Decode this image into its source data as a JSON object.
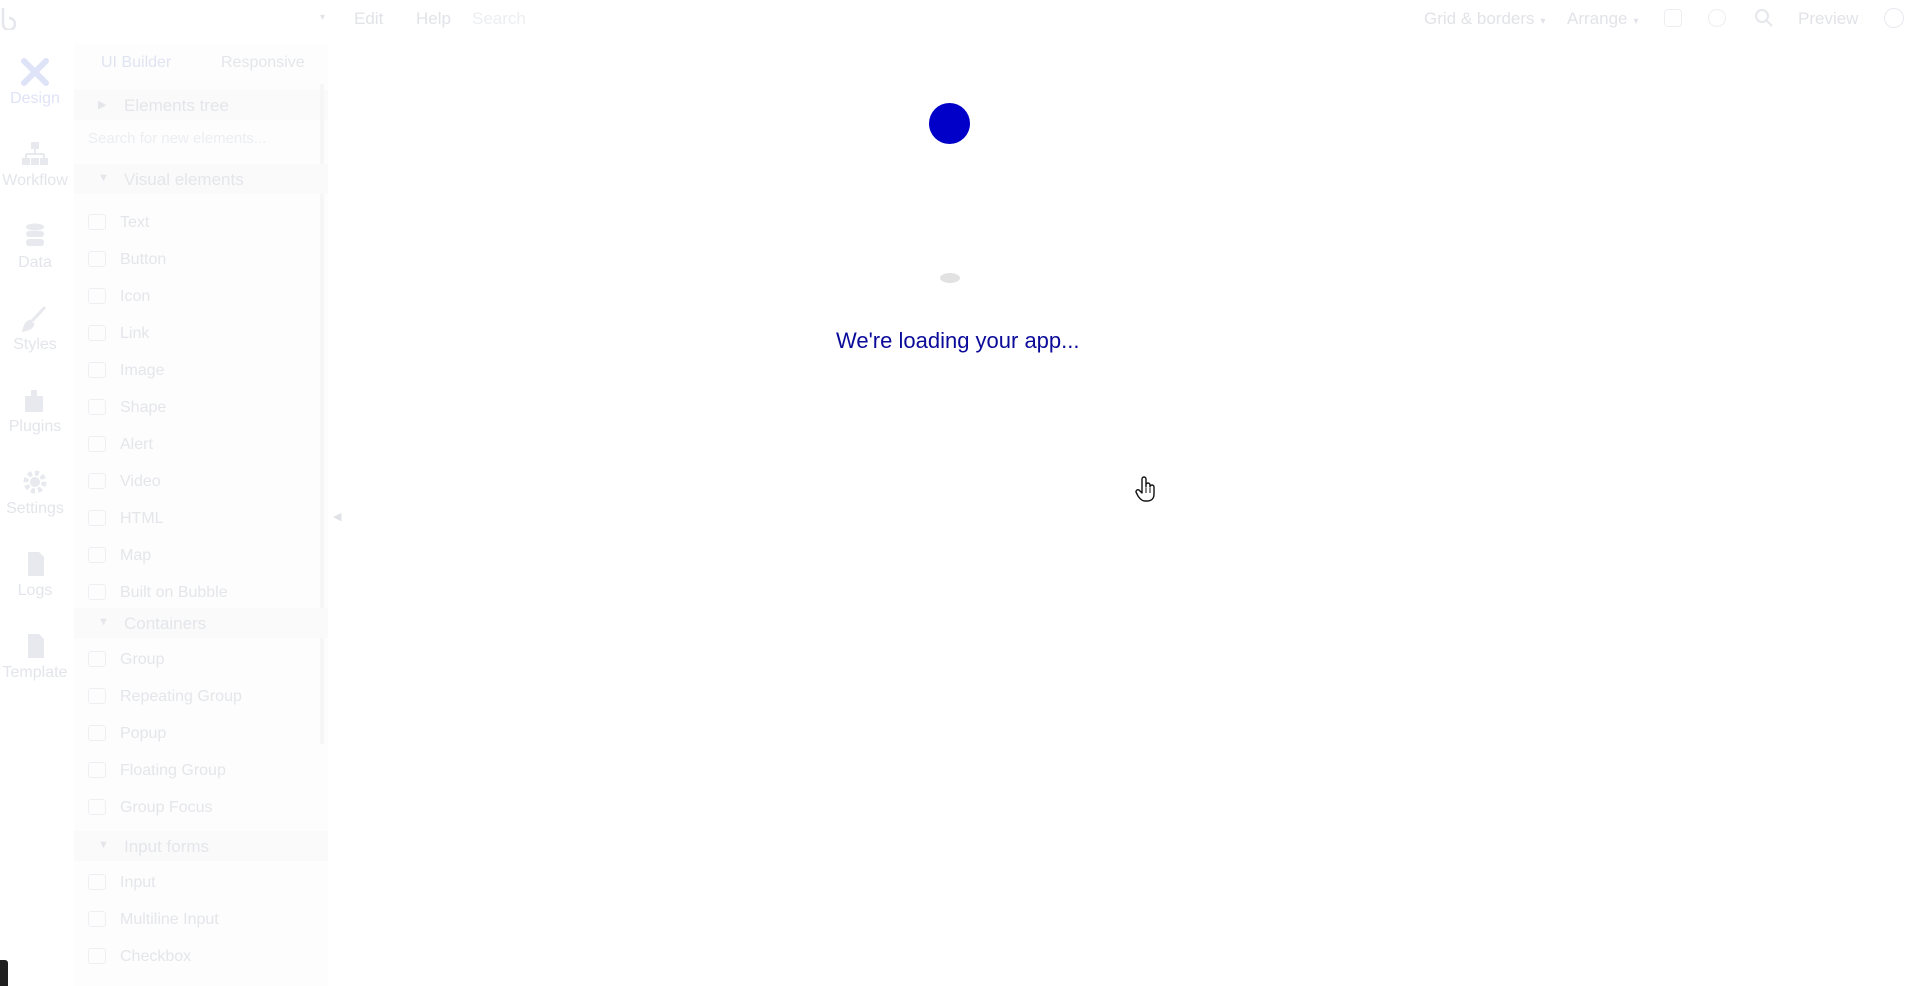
{
  "topbar": {
    "menu": [
      "Edit",
      "Help",
      "Search"
    ],
    "right": {
      "grid_label": "Grid & borders",
      "arrange_label": "Arrange",
      "preview_label": "Preview"
    }
  },
  "leftnav": {
    "items": [
      {
        "label": "Design",
        "icon": "design-icon"
      },
      {
        "label": "Workflow",
        "icon": "workflow-icon"
      },
      {
        "label": "Data",
        "icon": "data-icon"
      },
      {
        "label": "Styles",
        "icon": "styles-icon"
      },
      {
        "label": "Plugins",
        "icon": "plugins-icon"
      },
      {
        "label": "Settings",
        "icon": "settings-icon"
      },
      {
        "label": "Logs",
        "icon": "logs-icon"
      },
      {
        "label": "Template",
        "icon": "template-icon"
      }
    ]
  },
  "panel": {
    "tabs": [
      "UI Builder",
      "Responsive"
    ],
    "elements_tree": "Elements tree",
    "search_placeholder": "Search for new elements...",
    "sections": {
      "visual": {
        "title": "Visual elements",
        "items": [
          "Text",
          "Button",
          "Icon",
          "Link",
          "Image",
          "Shape",
          "Alert",
          "Video",
          "HTML",
          "Map",
          "Built on Bubble"
        ]
      },
      "containers": {
        "title": "Containers",
        "items": [
          "Group",
          "Repeating Group",
          "Popup",
          "Floating Group",
          "Group Focus"
        ]
      },
      "inputs": {
        "title": "Input forms",
        "items": [
          "Input",
          "Multiline Input",
          "Checkbox"
        ]
      }
    }
  },
  "loading": {
    "message": "We're loading your app...",
    "accent_color": "#0000c8",
    "text_color": "#0b0b9a"
  }
}
